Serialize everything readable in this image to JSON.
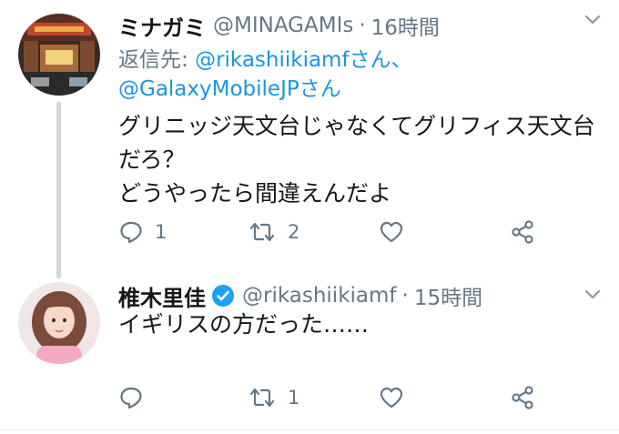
{
  "tweet1": {
    "display_name": "ミナガミ",
    "handle": "@MINAGAMIs",
    "separator": "·",
    "time": "16時間",
    "reply_prefix": "返信先: ",
    "reply_mention1": "@rikashiikiamfさん、",
    "reply_mention2": "@GalaxyMobileJPさん",
    "text": "グリニッジ天文台じゃなくてグリフィス天文台\nだろ？\nどうやったら間違えんだよ",
    "reply_count": "1",
    "retweet_count": "2",
    "like_count": "",
    "icons": {
      "avatar": "avatar",
      "caret": "chevron-down-icon",
      "reply": "reply-icon",
      "retweet": "retweet-icon",
      "like": "heart-icon",
      "share": "share-icon"
    }
  },
  "tweet2": {
    "display_name": "椎木里佳",
    "handle": "@rikashiikiamf",
    "separator": "·",
    "time": "15時間",
    "text": "イギリスの方だった……",
    "reply_count": "",
    "retweet_count": "1",
    "like_count": "",
    "icons": {
      "verified": "verified-badge-icon"
    }
  },
  "colors": {
    "link": "#1b95e0",
    "secondary": "#657786",
    "thread_line": "#cfd9de",
    "verified": "#1da1f2"
  }
}
